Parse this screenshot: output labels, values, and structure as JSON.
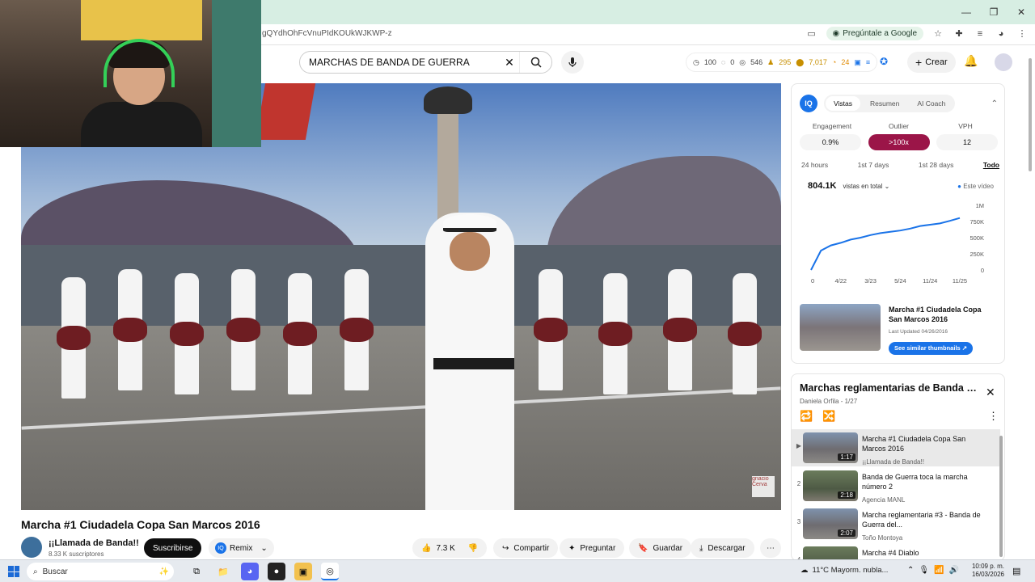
{
  "browser": {
    "url": "gQYdhOhFcVnuPIdKOUkWJKWP-z",
    "ask_google": "Pregúntale a Google"
  },
  "header": {
    "search_query": "MARCHAS DE BANDA DE GUERRA",
    "stats": [
      "100",
      "0",
      "546",
      "295",
      "7,017",
      "24"
    ],
    "create_label": "Crear"
  },
  "video": {
    "title": "Marcha #1 Ciudadela Copa San Marcos 2016",
    "watermark": "gnacio Cerva",
    "channel": {
      "name": "¡¡Llamada de Banda!!",
      "subscribers": "8.33 K suscriptores",
      "subscribe_label": "Suscribirse",
      "remix_label": "Remix"
    },
    "actions": {
      "likes": "7.3 K",
      "share": "Compartir",
      "ask": "Preguntar",
      "save": "Guardar",
      "download": "Descargar"
    }
  },
  "analytics": {
    "logo": "IQ",
    "tabs": [
      "Vistas",
      "Resumen",
      "AI Coach"
    ],
    "metric_labels": [
      "Engagement",
      "Outlier",
      "VPH"
    ],
    "metric_values": [
      "0.9%",
      ">100x",
      "12"
    ],
    "periods": [
      "24 hours",
      "1st 7 days",
      "1st 28 days",
      "Todo"
    ],
    "total_views": "804.1K",
    "views_select": "vistas en total",
    "legend": "Este vídeo",
    "thumb_title": "Marcha #1 Ciudadela Copa San Marcos 2016",
    "thumb_updated": "Last Updated 04/26/2016",
    "similar_button": "See similar thumbnails ↗"
  },
  "chart_data": {
    "type": "line",
    "x_tick_labels": [
      "0",
      "4/22",
      "3/23",
      "5/24",
      "11/24",
      "11/25"
    ],
    "y_tick_labels": [
      "0",
      "250K",
      "500K",
      "750K",
      "1M"
    ],
    "ylim": [
      0,
      1000000
    ],
    "series": [
      {
        "values": [
          0,
          300000,
          380000,
          420000,
          470000,
          500000,
          540000,
          570000,
          590000,
          610000,
          640000,
          680000,
          700000,
          720000,
          760000,
          804100
        ]
      }
    ],
    "grid": false
  },
  "playlist": {
    "title": "Marchas reglamentarias de Banda d...",
    "subtitle": "Daniela Orfila - 1/27",
    "items": [
      {
        "index": "▶",
        "title": "Marcha #1 Ciudadela Copa San Marcos 2016",
        "channel": "¡¡Llamada de Banda!!",
        "duration": "1:17"
      },
      {
        "index": "2",
        "title": "Banda de Guerra toca la marcha número 2",
        "channel": "Agencia MANL",
        "duration": "2:18"
      },
      {
        "index": "3",
        "title": "Marcha reglamentaria #3 - Banda de Guerra del...",
        "channel": "Toño Montoya",
        "duration": "2:07"
      },
      {
        "index": "4",
        "title": "Marcha #4 Diablo",
        "channel": "",
        "duration": ""
      }
    ]
  },
  "taskbar": {
    "search_placeholder": "Buscar",
    "weather": "11°C  Mayorm. nubla...",
    "time": "10:09 p. m.",
    "date": "16/03/2026"
  }
}
